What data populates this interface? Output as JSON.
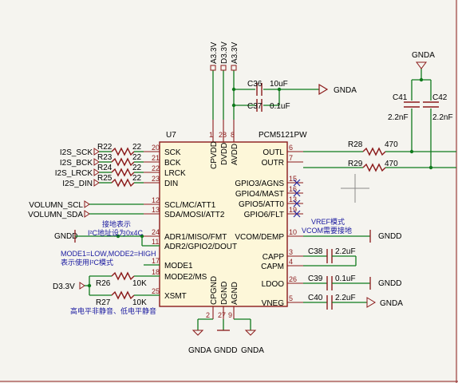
{
  "ic": {
    "ref": "U7",
    "value": "PCM5121PW",
    "left_pins": [
      {
        "num": "20",
        "name": "SCK"
      },
      {
        "num": "21",
        "name": "BCK"
      },
      {
        "num": "22",
        "name": "LRCK"
      },
      {
        "num": "23",
        "name": "DIN"
      },
      {
        "num": "12",
        "name": "SCL/MC/ATT1"
      },
      {
        "num": "13",
        "name": "SDA/MOSI/ATT2"
      },
      {
        "num": "24",
        "name": "ADR1/MISO/FMT"
      },
      {
        "num": "11",
        "name": "ADR2/GPIO2/DOUT"
      },
      {
        "num": "17",
        "name": "MODE1"
      },
      {
        "num": "18",
        "name": "MODE2/MS"
      },
      {
        "num": "25",
        "name": "XSMT"
      }
    ],
    "right_pins": [
      {
        "num": "6",
        "name": "OUTL"
      },
      {
        "num": "7",
        "name": "OUTR"
      },
      {
        "num": "15",
        "name": "GPIO3/AGNS"
      },
      {
        "num": "16",
        "name": "GPIO4/MAST"
      },
      {
        "num": "13",
        "name": "GPIO5/ATT0"
      },
      {
        "num": "19",
        "name": "GPIO6/FLT"
      },
      {
        "num": "10",
        "name": "VCOM/DEMP"
      },
      {
        "num": "3",
        "name": "CAPP"
      },
      {
        "num": "4",
        "name": "CAPM"
      },
      {
        "num": "26",
        "name": "LDOO"
      },
      {
        "num": "5",
        "name": "VNEG"
      }
    ],
    "top_pins": [
      {
        "num": "1",
        "name": "CPVDD"
      },
      {
        "num": "28",
        "name": "DVDD"
      },
      {
        "num": "8",
        "name": "AVDD"
      }
    ],
    "bottom_pins": [
      {
        "num": "2",
        "name": "CPGND"
      },
      {
        "num": "27",
        "name": "DGND"
      },
      {
        "num": "9",
        "name": "AGND"
      }
    ]
  },
  "rails": [
    "A3.3V",
    "D3.3V",
    "A3.3V"
  ],
  "inputs": [
    "I2S_SCK",
    "I2S_BCK",
    "I2S_LRCK",
    "I2S_DIN",
    "VOLUMN_SCL",
    "VOLUMN_SDA"
  ],
  "series_res": [
    {
      "ref": "R22",
      "val": "22"
    },
    {
      "ref": "R23",
      "val": "22"
    },
    {
      "ref": "R24",
      "val": "22"
    },
    {
      "ref": "R25",
      "val": "22"
    }
  ],
  "r26": {
    "ref": "R26",
    "val": "10K"
  },
  "r27": {
    "ref": "R27",
    "val": "10K"
  },
  "r28": {
    "ref": "R28",
    "val": "470"
  },
  "r29": {
    "ref": "R29",
    "val": "470"
  },
  "c36": {
    "ref": "C36",
    "val": "10uF"
  },
  "c37": {
    "ref": "C37",
    "val": "0.1uF"
  },
  "c38": {
    "ref": "C38",
    "val": "2.2uF"
  },
  "c39": {
    "ref": "C39",
    "val": "0.1uF"
  },
  "c40": {
    "ref": "C40",
    "val": "2.2uF"
  },
  "c41": {
    "ref": "C41",
    "val": "2.2nF"
  },
  "c42": {
    "ref": "C42",
    "val": "2.2nF"
  },
  "gnd_labels": {
    "gnda": "GNDA",
    "gndd": "GNDD"
  },
  "d33v": "D3.3V",
  "notes": {
    "addr_title": "接地表示",
    "addr_desc": "I²C地址设为0x4C",
    "mode_desc": "MODE1=LOW,MODE2=HIGH",
    "mode_desc2": "表示使用I²C模式",
    "vref_title": "VREF模式",
    "vref_desc": "VCOM需要接地",
    "mute_desc": "高电平非静音、低电平静音"
  }
}
